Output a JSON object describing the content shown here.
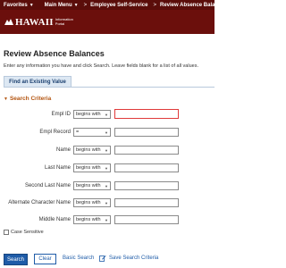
{
  "topbar": {
    "favorites": "Favorites",
    "main_menu": "Main Menu",
    "sep1": ">",
    "ess": "Employee Self-Service",
    "sep2": ">",
    "page": "Review Absence Balances"
  },
  "logo": {
    "name": "HAWAII",
    "sub1": "Information",
    "sub2": "Portal"
  },
  "page": {
    "title": "Review Absence Balances",
    "instructions": "Enter any information you have and click Search. Leave fields blank for a list of all values."
  },
  "tab": {
    "label": "Find an Existing Value"
  },
  "section": {
    "label": "Search Criteria"
  },
  "fields": [
    {
      "label": "Empl ID",
      "op": "begins with"
    },
    {
      "label": "Empl Record",
      "op": "="
    },
    {
      "label": "Name",
      "op": "begins with"
    },
    {
      "label": "Last Name",
      "op": "begins with"
    },
    {
      "label": "Second Last Name",
      "op": "begins with"
    },
    {
      "label": "Alternate Character Name",
      "op": "begins with"
    },
    {
      "label": "Middle Name",
      "op": "begins with"
    }
  ],
  "checkbox": {
    "label": "Case Sensitive"
  },
  "actions": {
    "search": "Search",
    "clear": "Clear",
    "basic_search": "Basic Search",
    "save_search": "Save Search Criteria"
  },
  "colors": {
    "header": "#5a0d0a",
    "banner": "#6b0f0c",
    "section": "#b3540f",
    "link": "#1f5ca8",
    "focus": "#e03a3a"
  },
  "icons": {
    "nav_arrow": "chevron-down-icon",
    "select_arrow": "chevron-down-icon",
    "section_toggle": "triangle-down-icon",
    "save": "edit-icon"
  }
}
